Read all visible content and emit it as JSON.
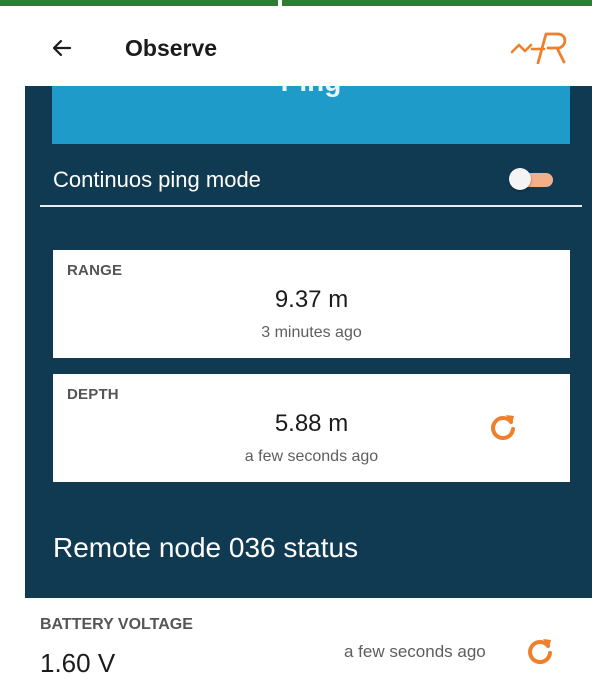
{
  "header": {
    "title": "Observe",
    "back_icon": "arrow-left-icon",
    "logo_icon": "app-logo-icon"
  },
  "colors": {
    "accent": "#f07f2c",
    "panel": "#103a52",
    "ping_button": "#1f9bc9",
    "top_bar": "#2e7d32"
  },
  "ping": {
    "label": "Ping"
  },
  "continuous_ping": {
    "label": "Continuos ping mode",
    "enabled": false
  },
  "range_card": {
    "label": "RANGE",
    "value": "9.37 m",
    "time": "3 minutes ago"
  },
  "depth_card": {
    "label": "DEPTH",
    "value": "5.88 m",
    "time": "a few seconds ago",
    "refresh_icon": "refresh-icon"
  },
  "remote_node": {
    "title": "Remote node 036 status"
  },
  "battery": {
    "label": "BATTERY VOLTAGE",
    "value": "1.60 V",
    "time": "a few seconds ago",
    "refresh_icon": "refresh-icon"
  }
}
